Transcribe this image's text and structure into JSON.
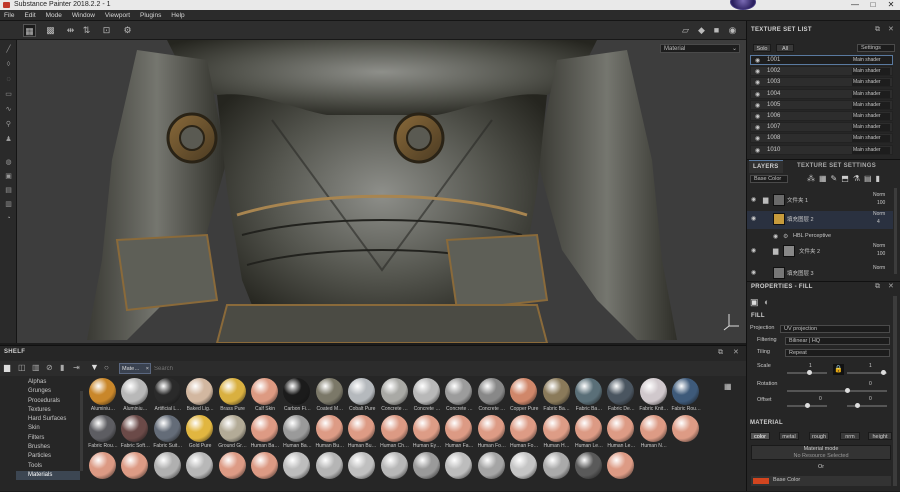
{
  "titlebar": {
    "title": "Substance Painter 2018.2.2 - 1",
    "minimize": "—",
    "maximize": "□",
    "close": "✕"
  },
  "menu": [
    "File",
    "Edit",
    "Mode",
    "Window",
    "Viewport",
    "Plugins",
    "Help"
  ],
  "viewport": {
    "material_mode": "Material"
  },
  "shelf": {
    "title": "SHELF",
    "search_placeholder": "Search",
    "filter_tag": "Mate…",
    "categories": [
      "Alphas",
      "Grunges",
      "Procedurals",
      "Textures",
      "Hard Surfaces",
      "Skin",
      "Filters",
      "Brushes",
      "Particles",
      "Tools",
      "Materials"
    ],
    "selected_category": "Materials",
    "materials": [
      {
        "name": "Aluminiu…",
        "color": "#c9872a"
      },
      {
        "name": "Aluminiu…",
        "color": "#b8b8b8"
      },
      {
        "name": "Artificial L…",
        "color": "#2a2a2a"
      },
      {
        "name": "Baked Lig…",
        "color": "#d2b7a0"
      },
      {
        "name": "Brass Pure",
        "color": "#d9b040"
      },
      {
        "name": "Calf Skin",
        "color": "#dd9a82"
      },
      {
        "name": "Carbon Fi…",
        "color": "#1b1b1b"
      },
      {
        "name": "Coated M…",
        "color": "#7b7868"
      },
      {
        "name": "Cobalt Pure",
        "color": "#b5b9bd"
      },
      {
        "name": "Concrete …",
        "color": "#a9a9a5"
      },
      {
        "name": "Concrete …",
        "color": "#b8b8b8"
      },
      {
        "name": "Concrete …",
        "color": "#9c9c9c"
      },
      {
        "name": "Concrete …",
        "color": "#888888"
      },
      {
        "name": "Copper Pure",
        "color": "#d0876a"
      },
      {
        "name": "Fabric Ba…",
        "color": "#8a7a5a"
      },
      {
        "name": "Fabric Ba…",
        "color": "#5a6f78"
      },
      {
        "name": "Fabric De…",
        "color": "#4a5560"
      },
      {
        "name": "Fabric Knit…",
        "color": "#d0c8cc"
      },
      {
        "name": "Fabric Rou…",
        "color": "#3e5a7a"
      },
      {
        "name": "Fabric Rou…",
        "color": "#5d5d62"
      },
      {
        "name": "Fabric Soft…",
        "color": "#6b4a48"
      },
      {
        "name": "Fabric Suit…",
        "color": "#646c78"
      },
      {
        "name": "Gold Pure",
        "color": "#e1b640"
      },
      {
        "name": "Ground Gr…",
        "color": "#b3ab97"
      },
      {
        "name": "Human Ba…",
        "color": "#dd9a84"
      },
      {
        "name": "Human Ba…",
        "color": "#9a9a9a"
      },
      {
        "name": "Human Bu…",
        "color": "#dd9b85"
      },
      {
        "name": "Human Bu…",
        "color": "#dd9b85"
      },
      {
        "name": "Human Ch…",
        "color": "#dc9a84"
      },
      {
        "name": "Human Ey…",
        "color": "#dd9c86"
      },
      {
        "name": "Human Fa…",
        "color": "#dc9a84"
      },
      {
        "name": "Human Fo…",
        "color": "#dd9b85"
      },
      {
        "name": "Human Fo…",
        "color": "#dd9b85"
      },
      {
        "name": "Human H…",
        "color": "#dd9c86"
      },
      {
        "name": "Human Le…",
        "color": "#dc9a84"
      },
      {
        "name": "Human Le…",
        "color": "#dd9b85"
      },
      {
        "name": "Human N…",
        "color": "#dd9b85"
      },
      {
        "name": "",
        "color": "#dd9b85"
      },
      {
        "name": "",
        "color": "#dc9a84"
      },
      {
        "name": "",
        "color": "#dd9b85"
      },
      {
        "name": "",
        "color": "#b0b0b0"
      },
      {
        "name": "",
        "color": "#b8b8b8"
      },
      {
        "name": "",
        "color": "#dd9b85"
      },
      {
        "name": "",
        "color": "#dc9a84"
      },
      {
        "name": "",
        "color": "#bdbdbd"
      },
      {
        "name": "",
        "color": "#b5b5b5"
      },
      {
        "name": "",
        "color": "#c0c0c0"
      },
      {
        "name": "",
        "color": "#b8b8b8"
      },
      {
        "name": "",
        "color": "#9a9a9a"
      },
      {
        "name": "",
        "color": "#bdbdbd"
      },
      {
        "name": "",
        "color": "#a5a5a5"
      },
      {
        "name": "",
        "color": "#c5c5c5"
      },
      {
        "name": "",
        "color": "#aaaaaa"
      },
      {
        "name": "",
        "color": "#5a5a5a"
      },
      {
        "name": "",
        "color": "#dd9b85"
      }
    ]
  },
  "texture_set_list": {
    "title": "TEXTURE SET LIST",
    "solo": "Solo",
    "all": "All",
    "settings": "Settings",
    "sets": [
      {
        "name": "1001",
        "shader": "Main shader"
      },
      {
        "name": "1002",
        "shader": "Main shader"
      },
      {
        "name": "1003",
        "shader": "Main shader"
      },
      {
        "name": "1004",
        "shader": "Main shader"
      },
      {
        "name": "1005",
        "shader": "Main shader"
      },
      {
        "name": "1006",
        "shader": "Main shader"
      },
      {
        "name": "1007",
        "shader": "Main shader"
      },
      {
        "name": "1008",
        "shader": "Main shader"
      },
      {
        "name": "1010",
        "shader": "Main shader"
      }
    ]
  },
  "layers": {
    "tab_layers": "LAYERS",
    "tab_settings": "TEXTURE SET SETTINGS",
    "channel": "Base Color",
    "items": [
      {
        "name": "文件夹 1",
        "blend": "Norm",
        "opacity": "100"
      },
      {
        "name": "填充图层 2",
        "blend": "Norm",
        "opacity": "4"
      },
      {
        "name": "HBL Perceptive",
        "blend": "",
        "opacity": ""
      },
      {
        "name": "文件夹 2",
        "blend": "Norm",
        "opacity": "100"
      },
      {
        "name": "填充图层 3",
        "blend": "Norm",
        "opacity": ""
      }
    ]
  },
  "properties": {
    "title": "PROPERTIES - FILL",
    "section_fill": "FILL",
    "projection_label": "Projection",
    "projection_value": "UV projection",
    "filtering_label": "Filtering",
    "filtering_value": "Bilinear | HQ",
    "tiling_label": "Tiling",
    "tiling_value": "Repeat",
    "scale_label": "Scale",
    "scale_value": "1",
    "scale_value_2": "1",
    "rotation_label": "Rotation",
    "rotation_value": "0",
    "offset_label": "Offset",
    "offset_x": "0",
    "offset_y": "0",
    "section_material": "MATERIAL",
    "channels": [
      "color",
      "metal",
      "rough",
      "nrm",
      "height"
    ],
    "material_mode": "Material mode",
    "no_resource": "No Resource Selected",
    "or": "Or",
    "base_color": "Base Color"
  }
}
